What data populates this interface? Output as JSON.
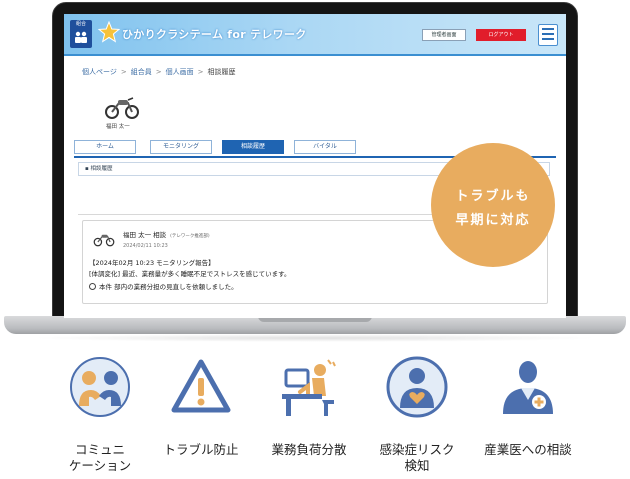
{
  "screen": {
    "org_badge": "組合",
    "app_title": "ひかりクラシテーム for テレワーク",
    "header_buttons": [
      "管理者画面",
      "ログアウト"
    ],
    "breadcrumb": [
      "個人ページ",
      "組合員",
      "個人画面",
      "相談履歴"
    ],
    "user_name": "福田 太一",
    "tabs": [
      "ホーム",
      "モニタリング",
      "相談履歴",
      "バイタル"
    ],
    "active_tab": "相談履歴",
    "section_title": "相談履歴",
    "post": {
      "poster": "福田 太一  相談",
      "poster_dept": "(テレワーク推進部)",
      "date": "2024/02/11 10:23",
      "line1": "【2024年02月 10:23 モニタリング報告】",
      "line2": "[体調変化] 最近、業務量が多く睡眠不足でストレスを感じています。",
      "line3": "本件 部内の業務分担の見直しを依頼しました。"
    }
  },
  "badge": {
    "line1": "トラブルも",
    "line2": "早期に対応"
  },
  "features": [
    {
      "label": "コミュニ\nケーション",
      "icon": "communication-icon"
    },
    {
      "label": "トラブル防止",
      "icon": "warning-icon"
    },
    {
      "label": "業務負荷分散",
      "icon": "workload-icon"
    },
    {
      "label": "感染症リスク\n検知",
      "icon": "infection-risk-icon"
    },
    {
      "label": "産業医への相談",
      "icon": "doctor-icon"
    }
  ],
  "colors": {
    "accent_orange": "#e8ac5f",
    "icon_blue": "#4c6fae",
    "icon_bg": "#e3ecf7",
    "tab_active": "#1f64b2"
  }
}
